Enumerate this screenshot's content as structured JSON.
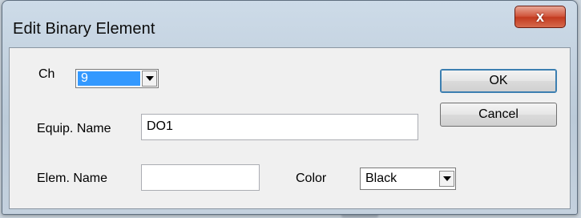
{
  "dialog": {
    "title": "Edit Binary Element",
    "close_glyph": "x",
    "close_icon": "close-icon"
  },
  "fields": {
    "ch_label": "Ch",
    "ch_value": "9",
    "equip_label": "Equip. Name",
    "equip_value": "DO1",
    "elem_label": "Elem. Name",
    "elem_value": "",
    "color_label": "Color",
    "color_value": "Black"
  },
  "buttons": {
    "ok_label": "OK",
    "cancel_label": "Cancel"
  },
  "colors": {
    "selection_highlight": "#3399ff",
    "close_button": "#c94a2f"
  }
}
